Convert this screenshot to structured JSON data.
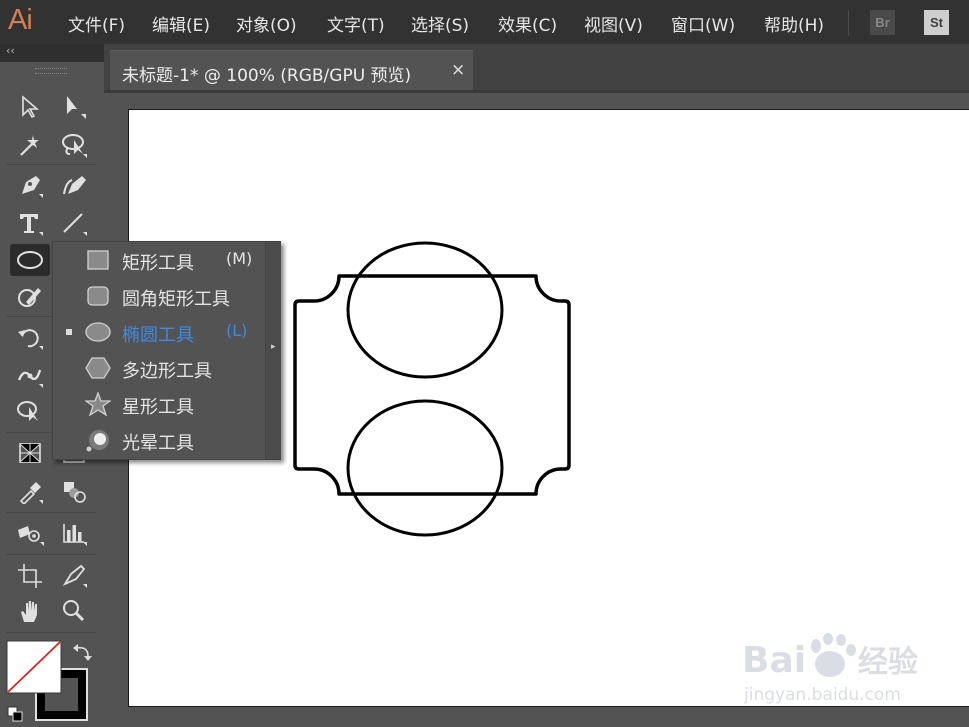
{
  "app": {
    "logo": "Ai"
  },
  "menu": [
    {
      "label": "文件(F)"
    },
    {
      "label": "编辑(E)"
    },
    {
      "label": "对象(O)"
    },
    {
      "label": "文字(T)"
    },
    {
      "label": "选择(S)"
    },
    {
      "label": "效果(C)"
    },
    {
      "label": "视图(V)"
    },
    {
      "label": "窗口(W)"
    },
    {
      "label": "帮助(H)"
    }
  ],
  "app_switcher": {
    "bridge": "Br",
    "stock": "St"
  },
  "toolbar": {
    "collapse": "‹‹",
    "tools": [
      "selection-tool",
      "direct-selection-tool",
      "magic-wand-tool",
      "lasso-tool",
      "pen-tool",
      "curvature-tool",
      "type-tool",
      "line-segment-tool",
      "ellipse-tool",
      "shaper-tool",
      "rotate-tool",
      "width-tool",
      "free-transform-tool",
      "shape-builder-tool",
      "perspective-grid-tool",
      "mesh-tool",
      "eyedropper-tool",
      "blend-tool",
      "symbol-sprayer-tool",
      "column-graph-tool",
      "artboard-tool",
      "slice-tool",
      "hand-tool",
      "zoom-tool"
    ],
    "active_tool": "ellipse-tool"
  },
  "document": {
    "tab_title": "未标题-1* @ 100% (RGB/GPU 预览)",
    "close": "×"
  },
  "flyout": {
    "items": [
      {
        "label": "矩形工具",
        "shortcut": "(M)",
        "icon": "rectangle-icon",
        "selected": false
      },
      {
        "label": "圆角矩形工具",
        "shortcut": "",
        "icon": "rounded-rectangle-icon",
        "selected": false
      },
      {
        "label": "椭圆工具",
        "shortcut": "(L)",
        "icon": "ellipse-icon",
        "selected": true
      },
      {
        "label": "多边形工具",
        "shortcut": "",
        "icon": "polygon-icon",
        "selected": false
      },
      {
        "label": "星形工具",
        "shortcut": "",
        "icon": "star-icon",
        "selected": false
      },
      {
        "label": "光晕工具",
        "shortcut": "",
        "icon": "flare-icon",
        "selected": false
      }
    ],
    "tearoff": "▸"
  },
  "colors": {
    "selected_item": "#3f8ae2",
    "logo": "#d27f52",
    "menubar": "#323232",
    "panel": "#535353",
    "stroke": "#000000"
  }
}
